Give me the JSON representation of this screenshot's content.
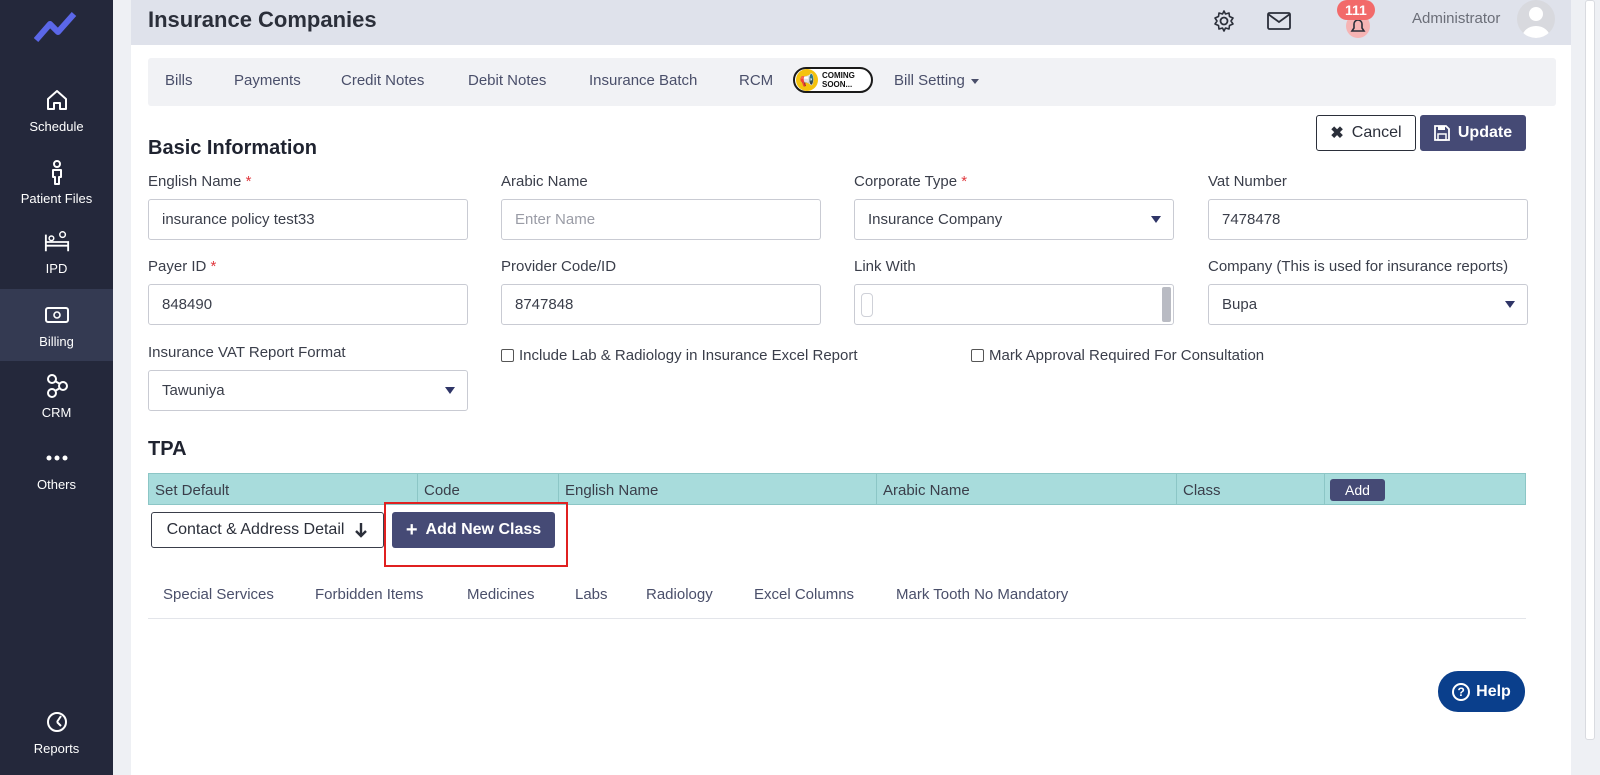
{
  "sidebar": {
    "items": [
      {
        "label": "Schedule",
        "icon": "home-icon"
      },
      {
        "label": "Patient Files",
        "icon": "person-icon"
      },
      {
        "label": "IPD",
        "icon": "bed-icon"
      },
      {
        "label": "Billing",
        "icon": "money-icon",
        "active": true
      },
      {
        "label": "CRM",
        "icon": "network-icon"
      },
      {
        "label": "Others",
        "icon": "more-icon"
      }
    ],
    "reports_label": "Reports"
  },
  "header": {
    "title": "Insurance Companies",
    "notification_count": "111",
    "user_name": "Administrator"
  },
  "tabs": {
    "bills": "Bills",
    "payments": "Payments",
    "credit_notes": "Credit Notes",
    "debit_notes": "Debit Notes",
    "insurance_batch": "Insurance Batch",
    "rcm": "RCM",
    "coming_soon_line1": "COMING",
    "coming_soon_line2": "SOON...",
    "bill_setting": "Bill Setting"
  },
  "actions": {
    "cancel": "Cancel",
    "update": "Update"
  },
  "basic_info": {
    "title": "Basic Information",
    "english_name_label": "English Name",
    "english_name_value": "insurance policy test33",
    "arabic_name_label": "Arabic Name",
    "arabic_name_placeholder": "Enter Name",
    "corporate_type_label": "Corporate Type",
    "corporate_type_value": "Insurance Company",
    "vat_number_label": "Vat Number",
    "vat_number_value": "7478478",
    "payer_id_label": "Payer ID",
    "payer_id_value": "848490",
    "provider_code_label": "Provider Code/ID",
    "provider_code_value": "8747848",
    "link_with_label": "Link With",
    "company_label": "Company (This is used for insurance reports)",
    "company_value": "Bupa",
    "vat_report_label": "Insurance VAT Report Format",
    "vat_report_value": "Tawuniya",
    "include_lab_label": "Include Lab & Radiology in Insurance Excel Report",
    "mark_approval_label": "Mark Approval Required For Consultation",
    "required_mark": "*"
  },
  "tpa": {
    "title": "TPA",
    "columns": [
      "Set Default",
      "Code",
      "English Name",
      "Arabic Name",
      "Class"
    ],
    "add_label": "Add"
  },
  "buttons": {
    "contact_address": "Contact & Address Detail",
    "add_new_class": "Add New Class"
  },
  "subtabs": [
    "Special Services",
    "Forbidden Items",
    "Medicines",
    "Labs",
    "Radiology",
    "Excel Columns",
    "Mark Tooth No Mandatory"
  ],
  "help": {
    "label": "Help"
  },
  "colors": {
    "sidebar_bg": "#24283b",
    "primary": "#454a75",
    "tpa_header": "#a8dcdc",
    "help": "#0a3f8c",
    "badge": "#f26a6a",
    "highlight": "#e02020"
  }
}
